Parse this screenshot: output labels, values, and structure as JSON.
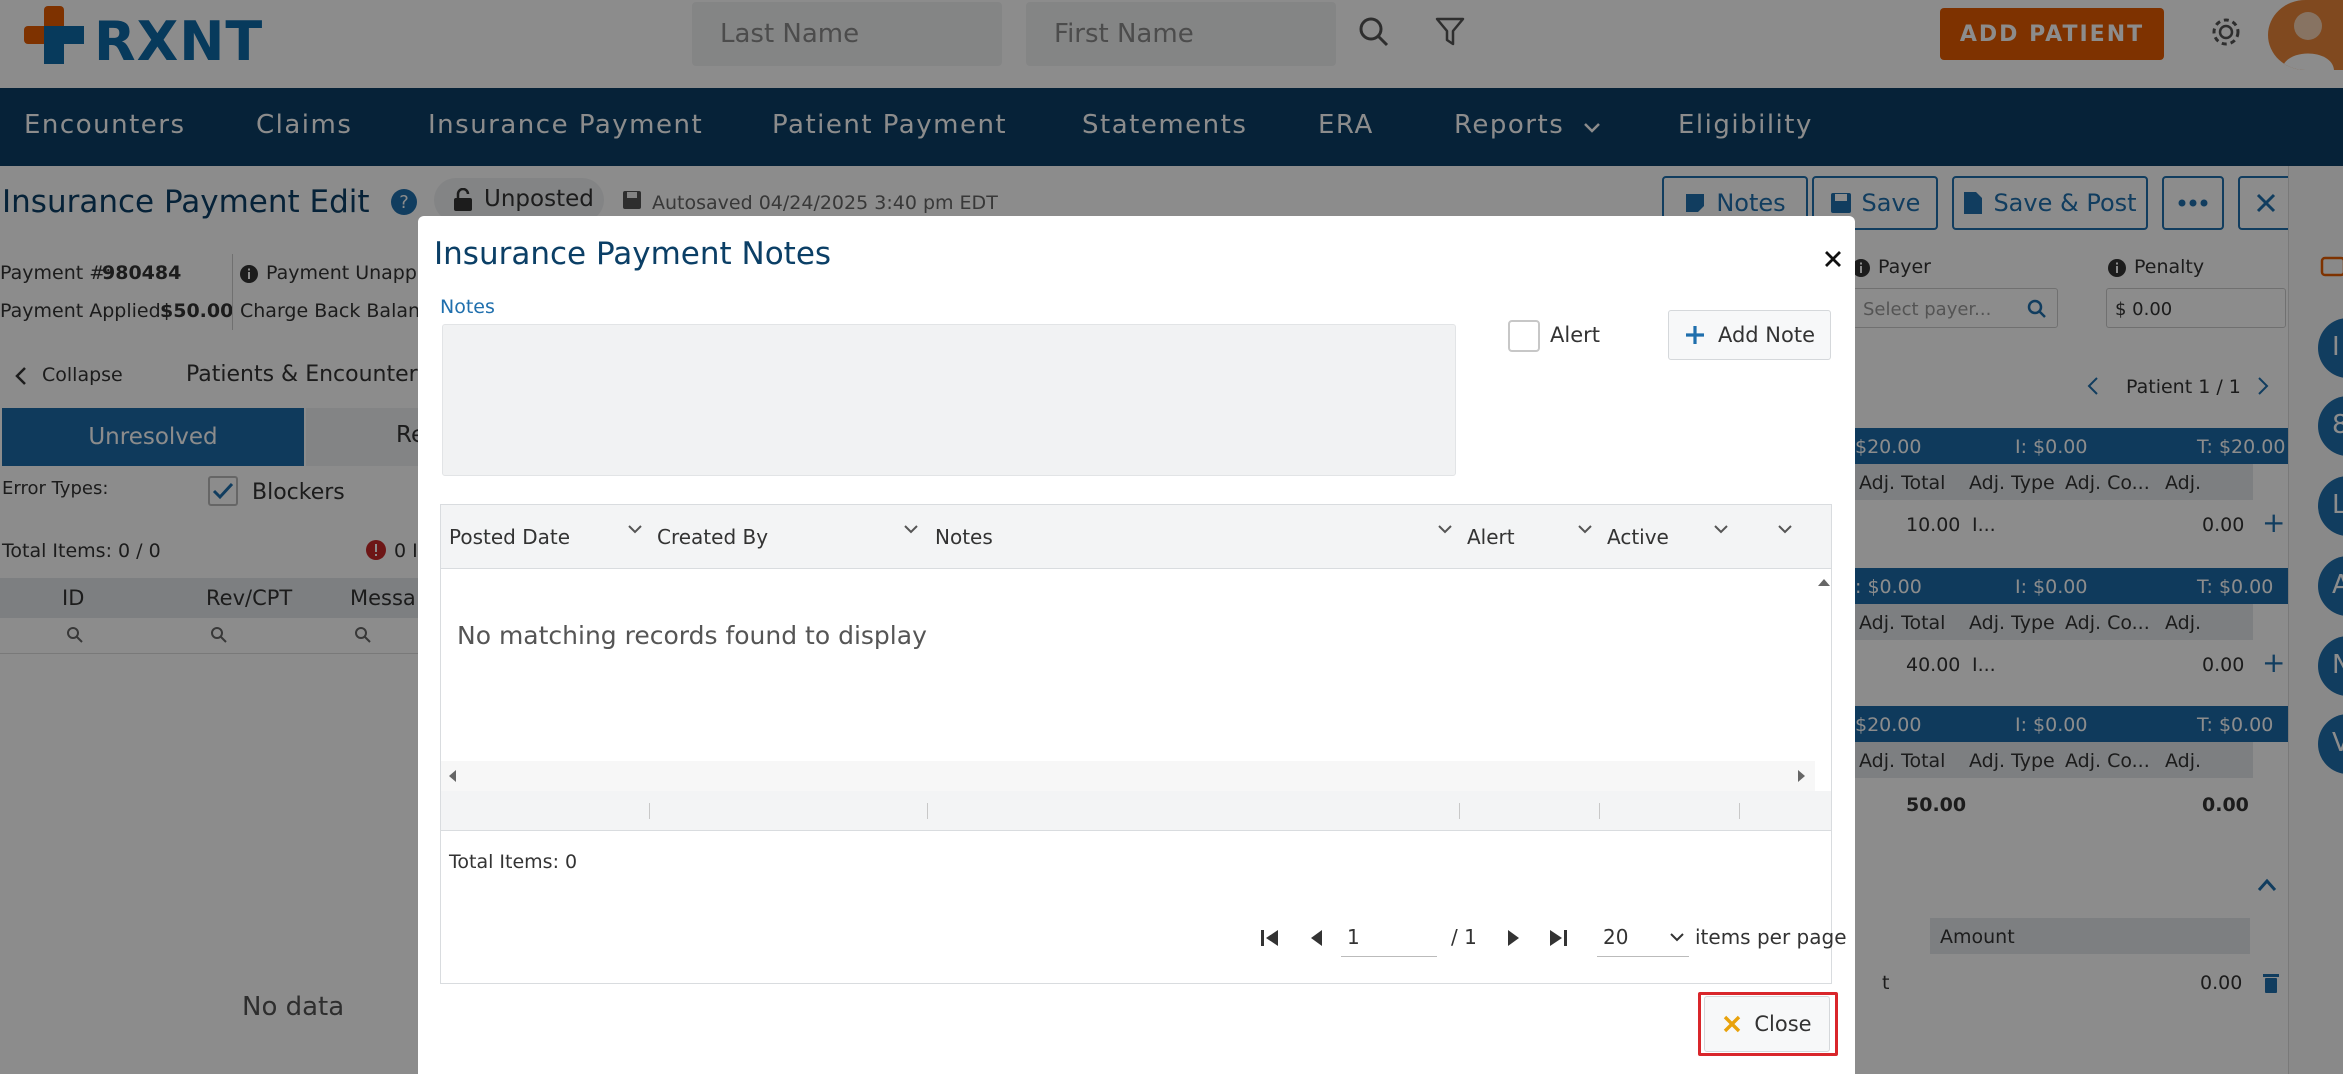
{
  "header": {
    "logo_text": "RXNT",
    "last_name_placeholder": "Last Name",
    "first_name_placeholder": "First Name",
    "add_patient_label": "ADD PATIENT"
  },
  "nav": {
    "items": [
      "Encounters",
      "Claims",
      "Insurance Payment",
      "Patient Payment",
      "Statements",
      "ERA",
      "Reports",
      "Eligibility"
    ]
  },
  "page": {
    "title": "Insurance Payment Edit",
    "status": "Unposted",
    "autosaved": "Autosaved 04/24/2025 3:40 pm EDT",
    "toolbar": {
      "notes": "Notes",
      "save": "Save",
      "save_post": "Save & Post"
    },
    "payment_no_label": "Payment #:",
    "payment_no_value": "980484",
    "payment_unapplied_label": "Payment Unappl",
    "payment_applied_label": "Payment Applied:",
    "payment_applied_value": "$50.00",
    "charge_back_label": "Charge Back Balanc",
    "payer_label": "Payer",
    "payer_placeholder": "Select payer...",
    "penalty_label": "Penalty",
    "penalty_value": "$ 0.00",
    "collapse_label": "Collapse",
    "patients_encounters_label": "Patients & Encounters",
    "patient_counter": "Patient 1 / 1",
    "unresolved_tab": "Unresolved",
    "resolved_tab_partial": "Re",
    "error_types_label": "Error Types:",
    "blockers_label": "Blockers",
    "total_items_left": "Total Items: 0 / 0",
    "error_count_partial": "0 I",
    "left_cols": [
      "ID",
      "Rev/CPT",
      "Messa"
    ],
    "no_data": "No data",
    "right_groups": [
      {
        "h1": "$20.00",
        "h2": "I: $0.00",
        "h3": "T: $20.00",
        "adj_total": "10.00",
        "adj_type": "I...",
        "adj": "0.00"
      },
      {
        "h1": ": $0.00",
        "h2": "I: $0.00",
        "h3": "T: $0.00",
        "adj_total": "40.00",
        "adj_type": "I...",
        "adj": "0.00"
      },
      {
        "h1": "$20.00",
        "h2": "I: $0.00",
        "h3": "T: $0.00",
        "adj_total": "50.00",
        "adj_type": "",
        "adj": "0.00"
      }
    ],
    "right_sub_cols": [
      "Adj. Total",
      "Adj. Type",
      "Adj. Co...",
      "Adj."
    ],
    "amount_label": "Amount",
    "amount_value": "0.00",
    "amount_left_partial": "t",
    "side_circle_letters": [
      "I",
      "8",
      "L",
      "A",
      "N",
      "V"
    ]
  },
  "modal": {
    "title": "Insurance Payment Notes",
    "notes_label": "Notes",
    "alert_label": "Alert",
    "add_note_label": "Add Note",
    "columns": [
      "Posted Date",
      "Created By",
      "Notes",
      "Alert",
      "Active"
    ],
    "empty_message": "No matching records found to display",
    "total_items": "Total Items: 0",
    "page_value": "1",
    "page_total": "/ 1",
    "per_page_value": "20",
    "per_page_label": "items per page",
    "close_label": "Close"
  },
  "colors": {
    "brand": "#0e6aa8",
    "nav_bg": "#0b3f66",
    "accent_orange": "#e65c00",
    "highlight_red": "#d9262b"
  }
}
